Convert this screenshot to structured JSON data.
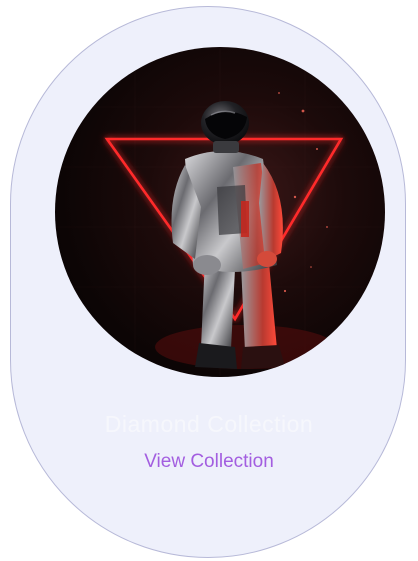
{
  "card": {
    "image_alt": "astronaut in chrome suit with red neon triangle",
    "title": "Diamond Collection",
    "link_label": "View Collection"
  },
  "colors": {
    "card_background": "#eef0fb",
    "card_border": "#b7b9d8",
    "link": "#a35ee0",
    "title": "#f6f7fc",
    "neon": "#ff2a2a"
  }
}
